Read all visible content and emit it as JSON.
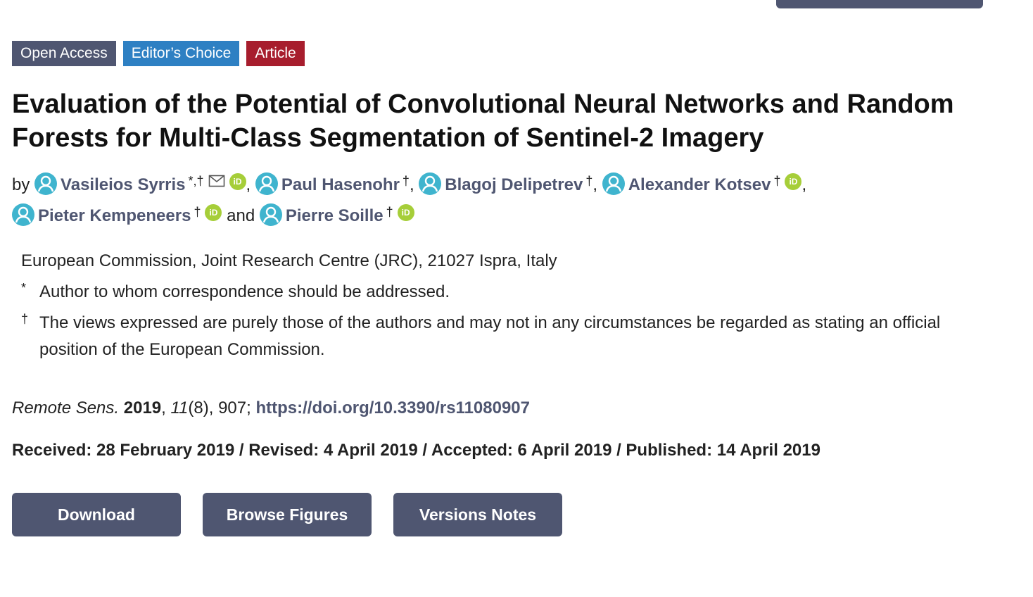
{
  "tags": {
    "open_access": "Open Access",
    "editors_choice": "Editor’s Choice",
    "article": "Article"
  },
  "title": "Evaluation of the Potential of Convolutional Neural Networks and Random Forests for Multi-Class Segmentation of Sentinel-2 Imagery",
  "authors": {
    "by": "by",
    "and": "and",
    "list": [
      {
        "name": "Vasileios Syrris",
        "sup": "*,†",
        "has_email": true,
        "has_orcid": true
      },
      {
        "name": "Paul Hasenohr",
        "sup": "†",
        "has_email": false,
        "has_orcid": false
      },
      {
        "name": "Blagoj Delipetrev",
        "sup": "†",
        "has_email": false,
        "has_orcid": false
      },
      {
        "name": "Alexander Kotsev",
        "sup": "†",
        "has_email": false,
        "has_orcid": true
      },
      {
        "name": "Pieter Kempeneers",
        "sup": "†",
        "has_email": false,
        "has_orcid": true
      },
      {
        "name": "Pierre Soille",
        "sup": "†",
        "has_email": false,
        "has_orcid": true
      }
    ],
    "orcid_label": "iD"
  },
  "affiliations": {
    "institution": "European Commission, Joint Research Centre (JRC), 21027 Ispra, Italy",
    "notes": [
      {
        "mark": "*",
        "text": "Author to whom correspondence should be addressed."
      },
      {
        "mark": "†",
        "text": "The views expressed are purely those of the authors and may not in any circumstances be regarded as stating an official position of the European Commission."
      }
    ]
  },
  "citation": {
    "journal": "Remote Sens.",
    "year": "2019",
    "volume": "11",
    "issue_pages": "(8), 907;",
    "doi": "https://doi.org/10.3390/rs11080907"
  },
  "dates": "Received: 28 February 2019 / Revised: 4 April 2019 / Accepted: 6 April 2019 / Published: 14 April 2019",
  "actions": {
    "download": "Download",
    "browse_figures": "Browse Figures",
    "versions_notes": "Versions Notes"
  },
  "colors": {
    "primary": "#4f5671",
    "editors_choice": "#2e80c3",
    "article": "#a71d2d",
    "avatar": "#3fb4ce",
    "orcid": "#a6ce39"
  },
  "icons": {
    "author": "user-icon",
    "email": "envelope-icon",
    "orcid": "orcid-icon"
  }
}
